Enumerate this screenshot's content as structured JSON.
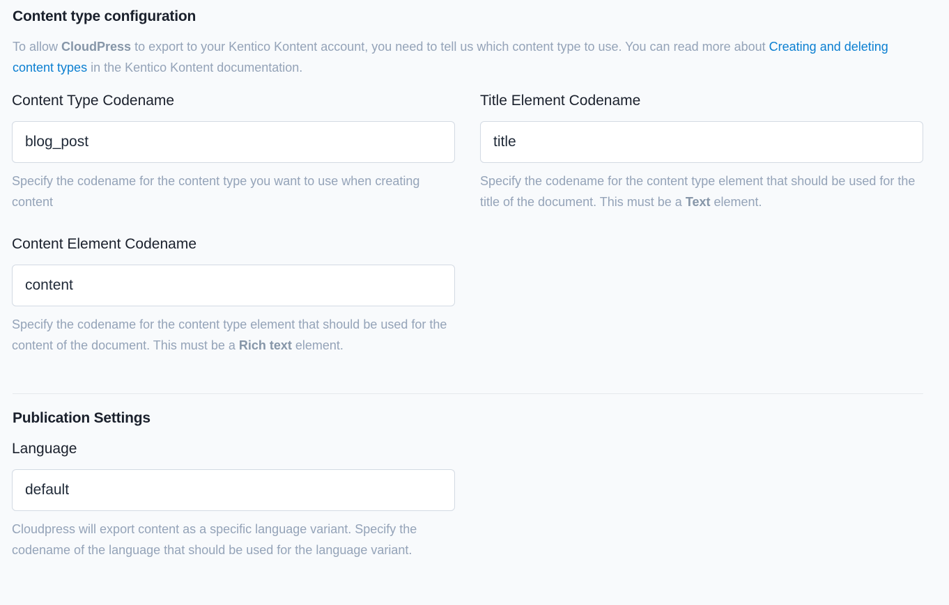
{
  "content_type_section": {
    "title": "Content type configuration",
    "desc_prefix": "To allow ",
    "desc_brand": "CloudPress",
    "desc_middle": " to export to your Kentico Kontent account, you need to tell us which content type to use. You can read more about ",
    "desc_link": "Creating and deleting content types",
    "desc_suffix": " in the Kentico Kontent documentation."
  },
  "fields": {
    "content_type_codename": {
      "label": "Content Type Codename",
      "value": "blog_post",
      "help": "Specify the codename for the content type you want to use when creating content"
    },
    "title_element_codename": {
      "label": "Title Element Codename",
      "value": "title",
      "help_prefix": "Specify the codename for the content type element that should be used for the title of the document. This must be a ",
      "help_strong": "Text",
      "help_suffix": " element."
    },
    "content_element_codename": {
      "label": "Content Element Codename",
      "value": "content",
      "help_prefix": "Specify the codename for the content type element that should be used for the content of the document. This must be a ",
      "help_strong": "Rich text",
      "help_suffix": " element."
    },
    "language": {
      "label": "Language",
      "value": "default",
      "help": "Cloudpress will export content as a specific language variant. Specify the codename of the language that should be used for the language variant."
    }
  },
  "publication_section": {
    "title": "Publication Settings"
  }
}
